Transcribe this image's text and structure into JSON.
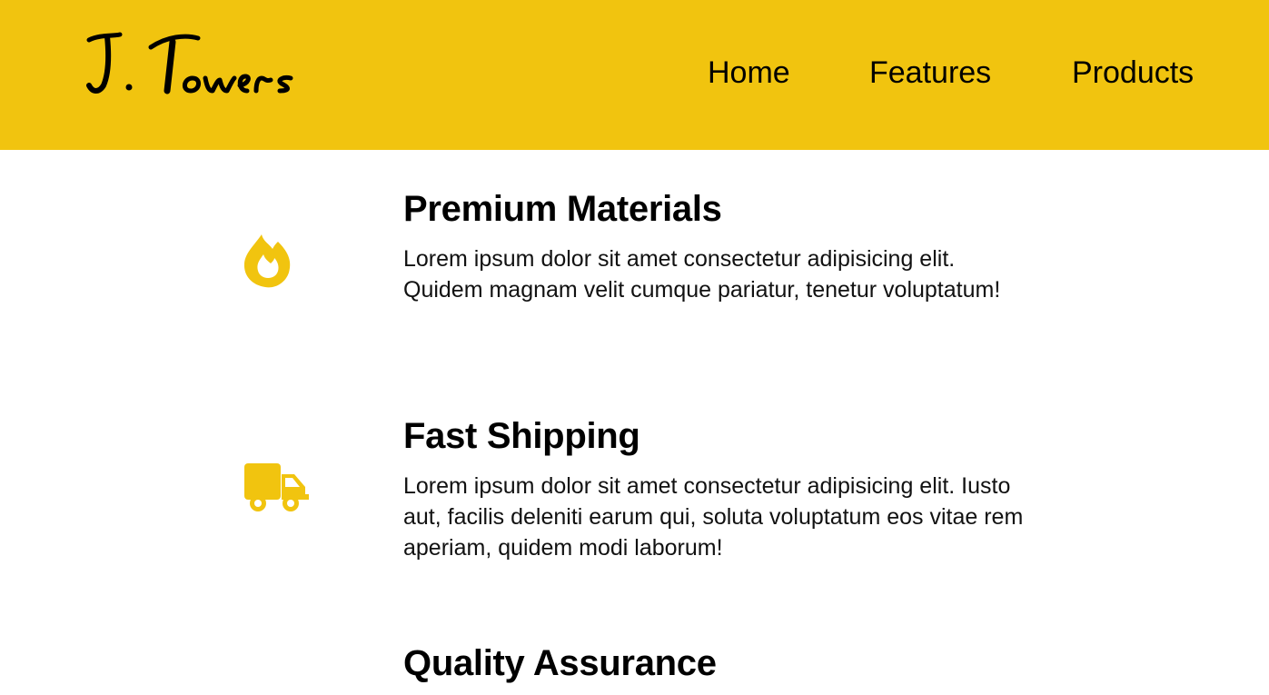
{
  "colors": {
    "header_background": "#f1c40f",
    "accent_icon": "#f1c40f",
    "text": "#000000",
    "page_background": "#ffffff"
  },
  "header": {
    "logo_text": "J. Towers",
    "nav": {
      "home": "Home",
      "features": "Features",
      "products": "Products"
    }
  },
  "features": [
    {
      "icon": "fire-icon",
      "title": "Premium Materials",
      "text": "Lorem ipsum dolor sit amet consectetur adipisicing elit. Quidem magnam velit cumque pariatur, tenetur voluptatum!"
    },
    {
      "icon": "truck-icon",
      "title": "Fast Shipping",
      "text": "Lorem ipsum dolor sit amet consectetur adipisicing elit. Iusto aut, facilis deleniti earum qui, soluta voluptatum eos vitae rem aperiam, quidem modi laborum!"
    },
    {
      "icon": "",
      "title": "Quality Assurance",
      "text": ""
    }
  ]
}
